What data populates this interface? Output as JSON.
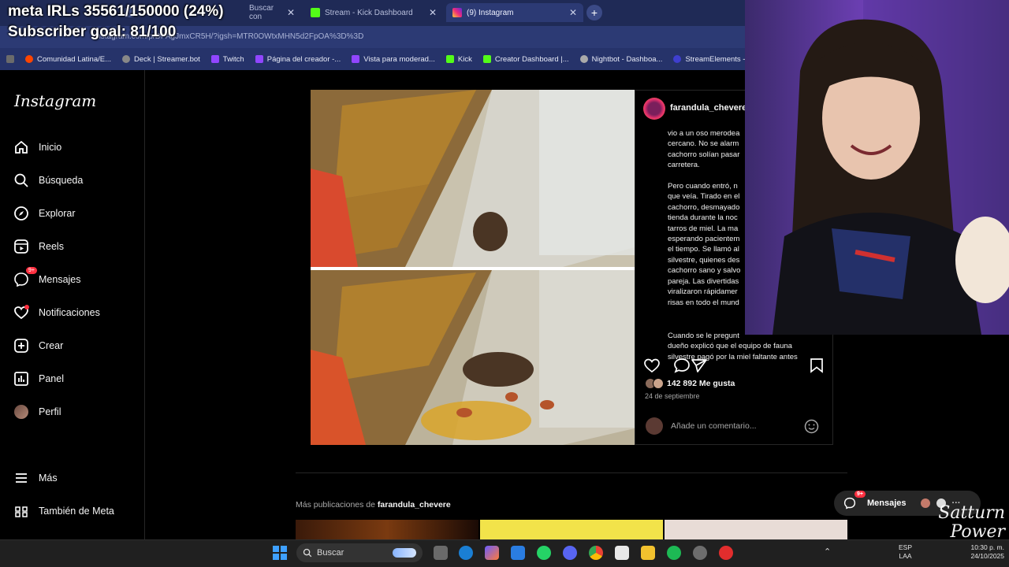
{
  "overlay": {
    "irl_meta": "meta IRLs 35561/150000 (24%)",
    "subscriber_goal": "Subscriber goal: 81/100"
  },
  "browser": {
    "tabs": [
      {
        "label": "Buscar con",
        "active": false
      },
      {
        "label": "Stream - Kick Dashboard",
        "active": false
      },
      {
        "label": "(9) Instagram",
        "active": true
      }
    ],
    "url": "instagram.com/p/DPAgJmxCR5H/?igsh=MTR0OWtxMHN5d2FpOA%3D%3D",
    "bookmarks": [
      "Comunidad Latina/E...",
      "Deck | Streamer.bot",
      "Twitch",
      "Página del creador -...",
      "Vista para moderad...",
      "Kick",
      "Creator Dashboard |...",
      "Nightbot - Dashboa...",
      "StreamElements - M..."
    ]
  },
  "instagram": {
    "logo": "Instagram",
    "nav": [
      {
        "label": "Inicio",
        "icon": "home-icon"
      },
      {
        "label": "Búsqueda",
        "icon": "search-icon"
      },
      {
        "label": "Explorar",
        "icon": "compass-icon"
      },
      {
        "label": "Reels",
        "icon": "reels-icon"
      },
      {
        "label": "Mensajes",
        "icon": "messenger-icon",
        "badge": "9+"
      },
      {
        "label": "Notificaciones",
        "icon": "heart-icon"
      },
      {
        "label": "Crear",
        "icon": "plus-square-icon"
      },
      {
        "label": "Panel",
        "icon": "chart-icon"
      },
      {
        "label": "Perfil",
        "icon": "profile-avatar"
      }
    ],
    "more": "Más",
    "meta": "También de Meta",
    "post": {
      "username": "farandula_chevere",
      "caption": "vio a un oso merodea\ncercano. No se alarm\ncachorro solían pasar\ncarretera.\n\nPero cuando entró, n\nque veía. Tirado en el\ncachorro, desmayado\ntienda durante la noc\ntarros de miel. La ma\nesperando pacientem\nel tiempo. Se llamó al\nsilvestre, quienes des\ncachorro sano y salvo\npareja. Las divertidas\nviralizaron rápidamer\nrisas en todo el mund",
      "caption_tail": "Cuando se le pregunt\ndueño explicó que el equipo de fauna\nsilvestre pagó por la miel faltante antes",
      "likes": "142 892 Me gusta",
      "date": "24 de septiembre",
      "comment_placeholder": "Añade un comentario..."
    },
    "more_posts_prefix": "Más publicaciones de ",
    "more_posts_user": "farandula_chevere",
    "messages_pill": "Mensajes",
    "messages_badge": "9+"
  },
  "watermark": {
    "line1": "Satturn",
    "line2": "Power"
  },
  "taskbar": {
    "search": "Buscar",
    "lang": "ESP",
    "lang2": "LAA",
    "time": "10:30 p. m.",
    "date": "24/10/2025"
  }
}
